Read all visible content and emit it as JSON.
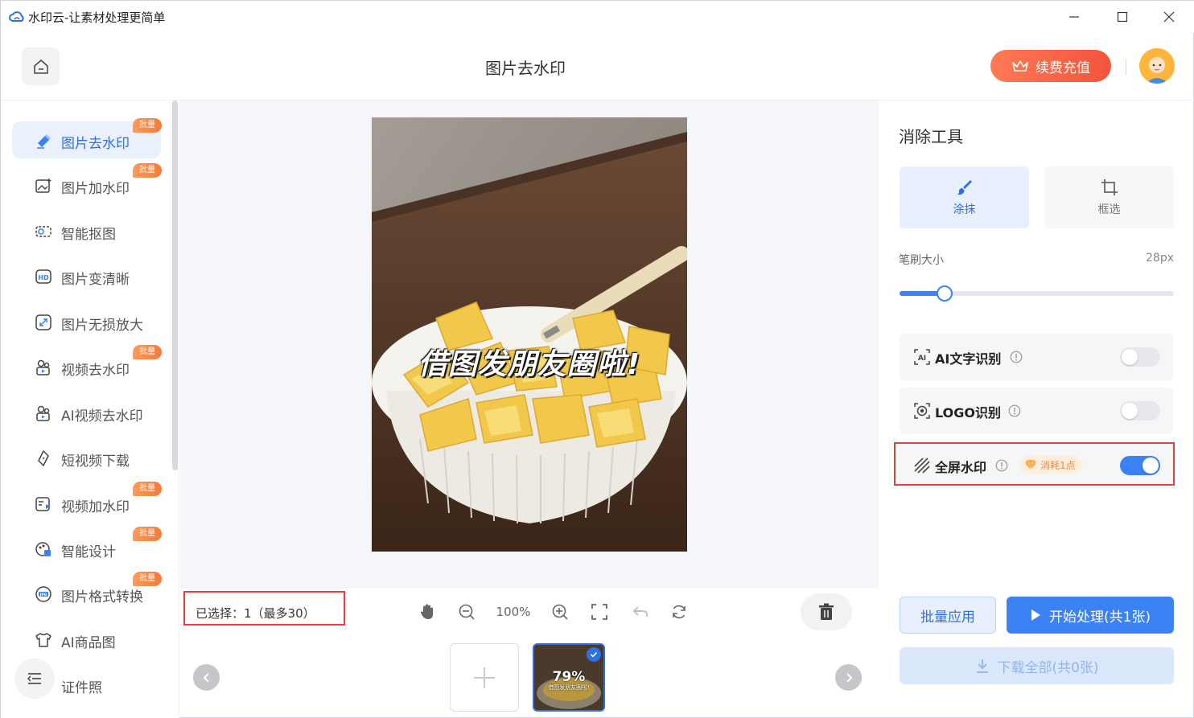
{
  "window": {
    "title": "水印云-让素材处理更简单"
  },
  "header": {
    "page_title": "图片去水印",
    "recharge_label": "续费充值"
  },
  "sidebar": {
    "items": [
      {
        "label": "图片去水印",
        "badge": "批量",
        "icon": "eraser-icon",
        "active": true
      },
      {
        "label": "图片加水印",
        "badge": "批量",
        "icon": "image-add-icon"
      },
      {
        "label": "智能抠图",
        "badge": "",
        "icon": "cutout-icon"
      },
      {
        "label": "图片变清晰",
        "badge": "",
        "icon": "hd-icon"
      },
      {
        "label": "图片无损放大",
        "badge": "",
        "icon": "enlarge-icon"
      },
      {
        "label": "视频去水印",
        "badge": "批量",
        "icon": "video-clean-icon"
      },
      {
        "label": "AI视频去水印",
        "badge": "",
        "icon": "ai-video-icon"
      },
      {
        "label": "短视频下载",
        "badge": "",
        "icon": "download-video-icon"
      },
      {
        "label": "视频加水印",
        "badge": "批量",
        "icon": "video-add-icon"
      },
      {
        "label": "智能设计",
        "badge": "批量",
        "icon": "design-icon"
      },
      {
        "label": "图片格式转换",
        "badge": "批量",
        "icon": "jpg-icon"
      },
      {
        "label": "AI商品图",
        "badge": "",
        "icon": "tshirt-icon"
      },
      {
        "label": "证件照",
        "badge": "",
        "icon": "id-photo-icon"
      }
    ]
  },
  "canvas": {
    "image_caption": "借图发朋友圈啦!",
    "selected_text": "已选择：1（最多30）",
    "zoom_level": "100%"
  },
  "thumbnails": {
    "items": [
      {
        "progress_text": "79%",
        "caption": "借图发朋友圈啦!",
        "selected": true
      }
    ]
  },
  "panel": {
    "title": "消除工具",
    "tools": [
      {
        "label": "涂抹",
        "active": true
      },
      {
        "label": "框选",
        "active": false
      }
    ],
    "brush_label": "笔刷大小",
    "brush_value": "28px",
    "brush_fraction": 0.16,
    "options": [
      {
        "label": "AI文字识别",
        "enabled": false
      },
      {
        "label": "LOGO识别",
        "enabled": false
      },
      {
        "label": "全屏水印",
        "enabled": true,
        "cost": "消耗1点"
      }
    ],
    "batch_label": "批量应用",
    "start_label": "开始处理(共1张)",
    "download_label": "下载全部(共0张)"
  },
  "colors": {
    "accent": "#3b82f6",
    "recharge": "#f4533b",
    "highlight_border": "#e34040",
    "badge": "#f57a3a"
  }
}
